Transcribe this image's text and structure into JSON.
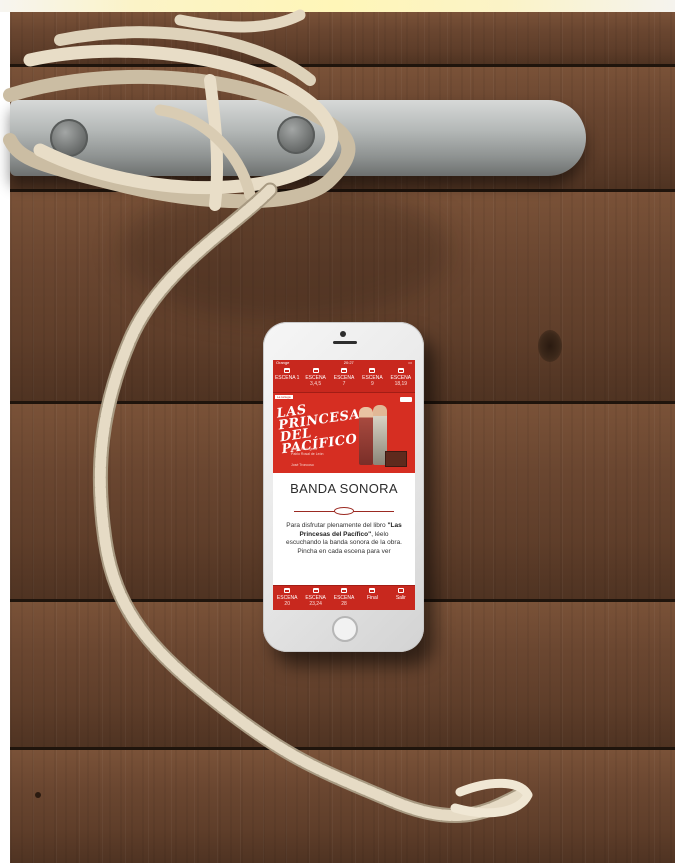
{
  "phone": {
    "status": {
      "carrier": "Orange",
      "time": "20:27"
    },
    "top_tabs": [
      {
        "label": "ESCENA 1",
        "sub": ""
      },
      {
        "label": "ESCENA",
        "sub": "3,4,5"
      },
      {
        "label": "ESCENA",
        "sub": "7"
      },
      {
        "label": "ESCENA",
        "sub": "9"
      },
      {
        "label": "ESCENA",
        "sub": "18,19"
      }
    ],
    "banner": {
      "tag": "La tortuga",
      "title_line1": "LAS",
      "title_line2": "PRINCESAS",
      "title_line3": "DEL PACÍFICO",
      "credit_line1": "Alana Rodríguez",
      "credit_line2": "Pablo Rosal de León",
      "credit_line3": "José Troncoso"
    },
    "content": {
      "heading": "BANDA SONORA",
      "text_before": "Para disfrutar plenamente del libro ",
      "book_title": "\"Las Princesas del Pacífico\"",
      "text_after": ", léelo escuchando la banda sonora de la obra. Pincha en cada escena para ver"
    },
    "bottom_tabs": [
      {
        "label": "ESCENA",
        "sub": "20"
      },
      {
        "label": "ESCENA",
        "sub": "23,24"
      },
      {
        "label": "ESCENA",
        "sub": "28"
      },
      {
        "label": "Final",
        "sub": ""
      },
      {
        "label": "Salir",
        "sub": ""
      }
    ]
  },
  "colors": {
    "app_red": "#c8281e",
    "wood": "#6a4630",
    "rope": "#e7dcc8",
    "cleat": "#b4b8b7"
  },
  "icons": [
    "folder-icon",
    "exit-icon",
    "bolt-icon"
  ]
}
